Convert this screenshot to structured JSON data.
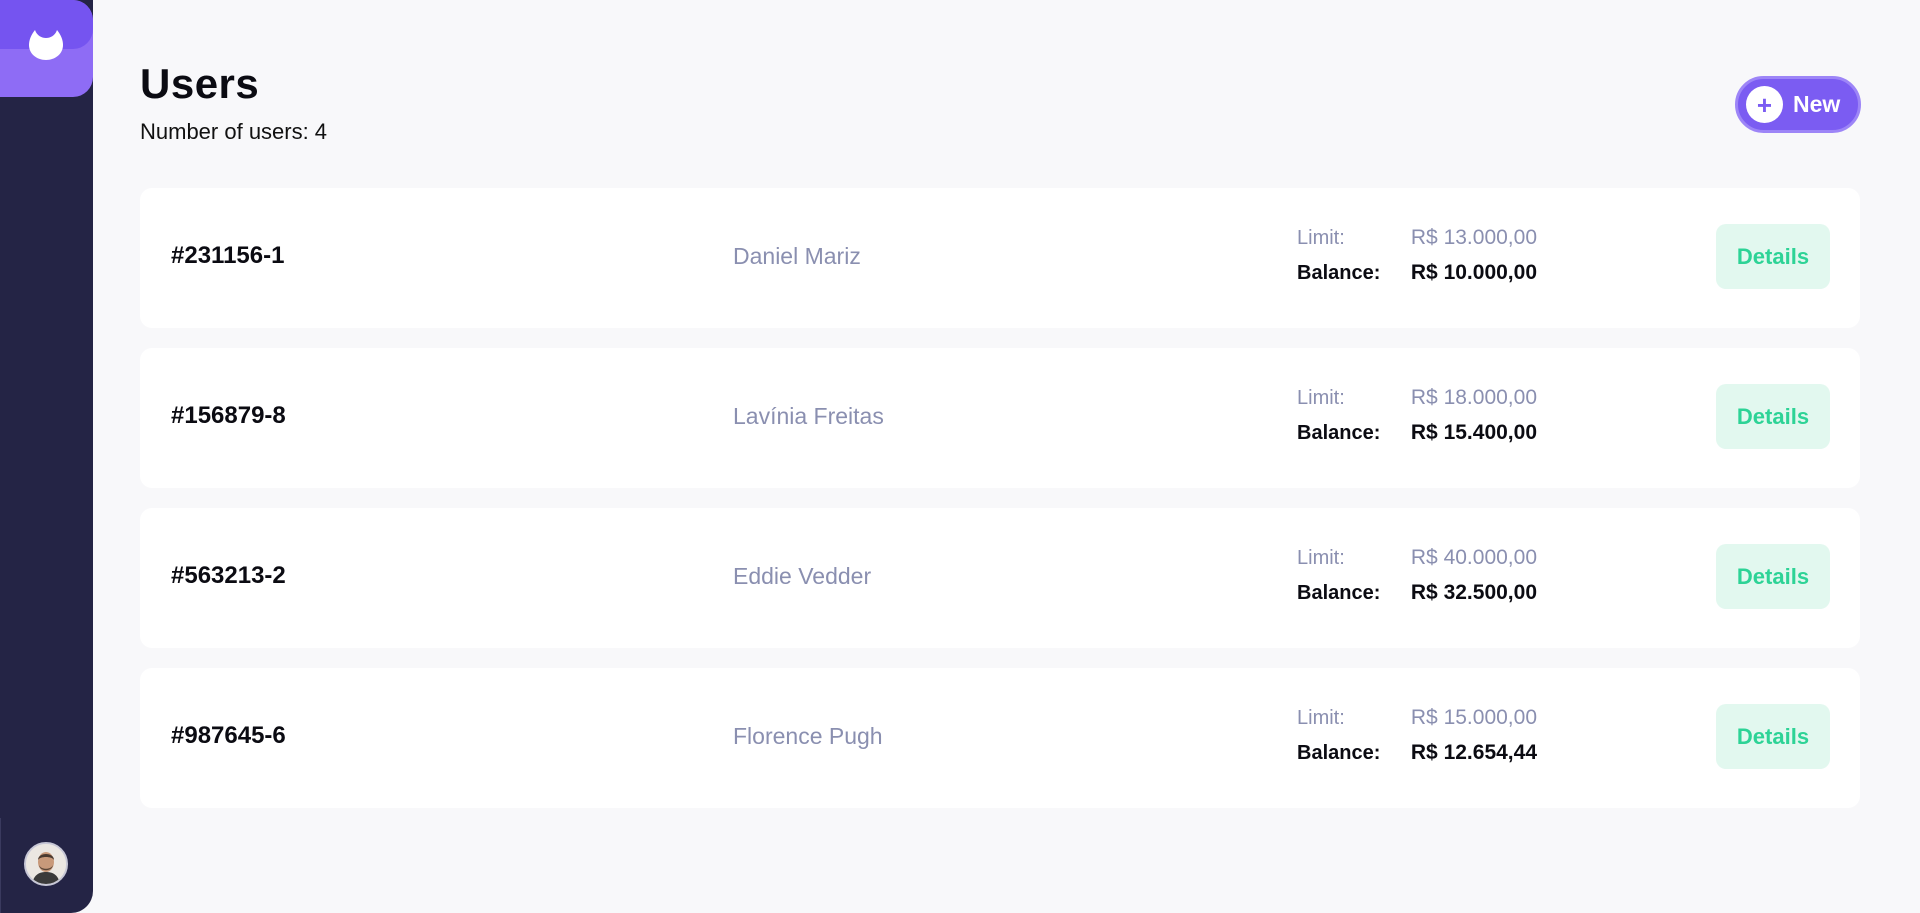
{
  "header": {
    "title": "Users",
    "subtitle_label": "Number of users:",
    "user_count": "4",
    "new_button_label": "New"
  },
  "users": [
    {
      "id": "#231156-1",
      "name": "Daniel Mariz",
      "limit_label": "Limit:",
      "limit": "R$ 13.000,00",
      "balance_label": "Balance:",
      "balance": "R$ 10.000,00",
      "details_label": "Details"
    },
    {
      "id": "#156879-8",
      "name": "Lavínia Freitas",
      "limit_label": "Limit:",
      "limit": "R$ 18.000,00",
      "balance_label": "Balance:",
      "balance": "R$ 15.400,00",
      "details_label": "Details"
    },
    {
      "id": "#563213-2",
      "name": "Eddie Vedder",
      "limit_label": "Limit:",
      "limit": "R$ 40.000,00",
      "balance_label": "Balance:",
      "balance": "R$ 32.500,00",
      "details_label": "Details"
    },
    {
      "id": "#987645-6",
      "name": "Florence Pugh",
      "limit_label": "Limit:",
      "limit": "R$ 15.000,00",
      "balance_label": "Balance:",
      "balance": "R$ 12.654,44",
      "details_label": "Details"
    }
  ],
  "sidebar": {
    "logo_icon": "drop-logo-icon",
    "avatar_icon": "user-avatar"
  },
  "colors": {
    "sidebar": "#242445",
    "accent": "#7b5cf2",
    "logo": "#8e6cf5",
    "details_bg": "#e2f8ef",
    "details_text": "#2dd396",
    "muted_text": "#8a8fb0",
    "page_bg": "#f8f8fa"
  }
}
